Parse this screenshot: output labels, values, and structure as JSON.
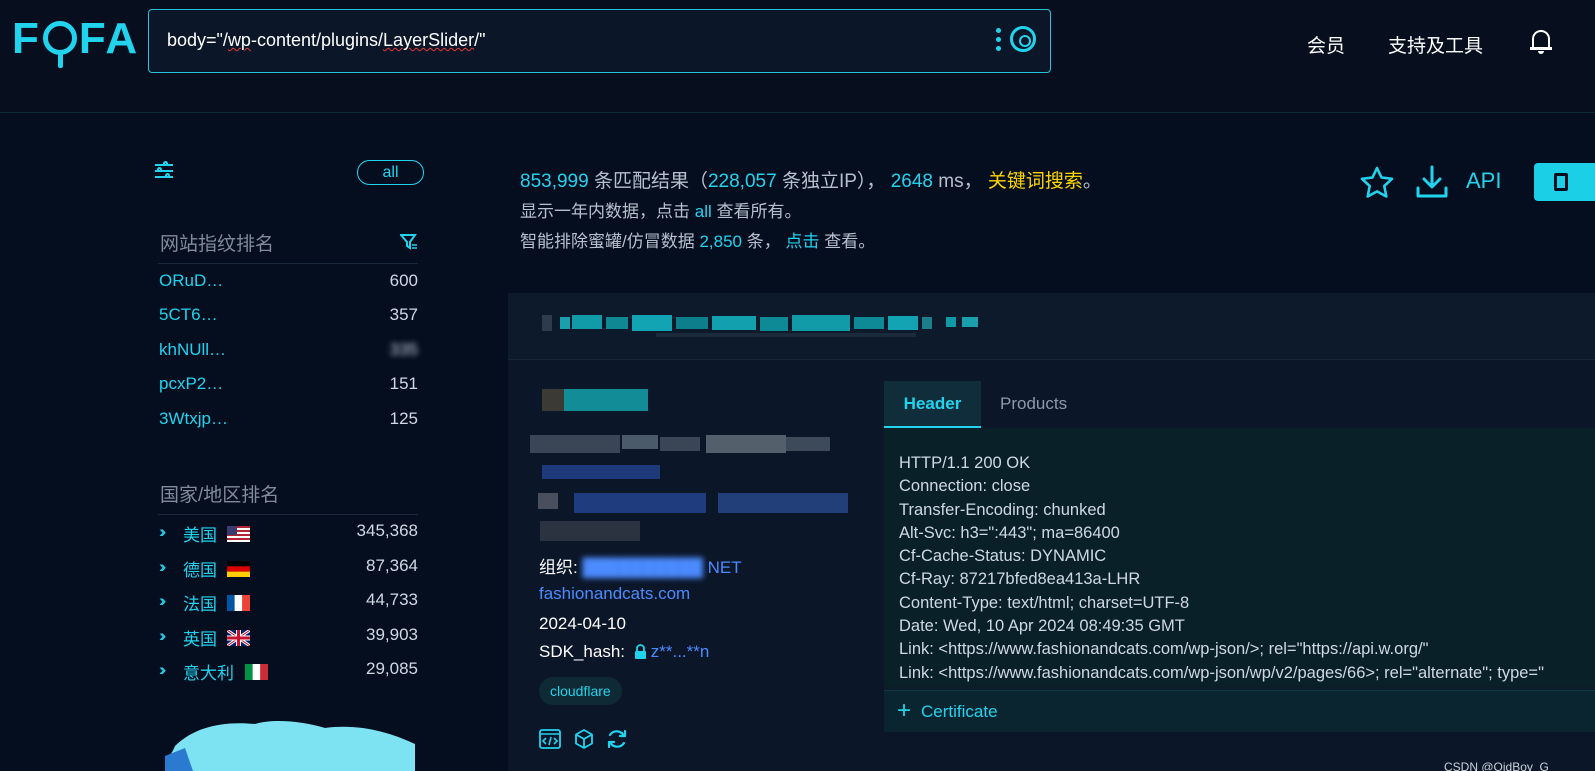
{
  "header": {
    "logo": "FOFA",
    "search_query": "body=\"/wp-content/plugins/LayerSlider/\"",
    "nav": [
      "会员",
      "支持及工具"
    ]
  },
  "sidebar": {
    "all_label": "all",
    "fingerprint_title": "网站指纹排名",
    "fingerprints": [
      {
        "name": "ORuD…",
        "count": "600"
      },
      {
        "name": "5CT6…",
        "count": "357"
      },
      {
        "name": "khNUll…",
        "count": "335"
      },
      {
        "name": "pcxP2…",
        "count": "151"
      },
      {
        "name": "3Wtxjp…",
        "count": "125"
      }
    ],
    "country_title": "国家/地区排名",
    "countries": [
      {
        "name": "美国",
        "count": "345,368",
        "flag": "us"
      },
      {
        "name": "德国",
        "count": "87,364",
        "flag": "de"
      },
      {
        "name": "法国",
        "count": "44,733",
        "flag": "fr"
      },
      {
        "name": "英国",
        "count": "39,903",
        "flag": "gb"
      },
      {
        "name": "意大利",
        "count": "29,085",
        "flag": "it"
      }
    ]
  },
  "summary": {
    "total": "853,999",
    "total_label": "条匹配结果（",
    "unique_ip": "228,057",
    "unique_ip_label": "条独立IP），",
    "ms": "2648",
    "ms_label": "ms，",
    "keyword_search": "关键词搜索",
    "period": "。",
    "line2_prefix": "显示一年内数据，点击",
    "line2_link": "all",
    "line2_suffix": "查看所有。",
    "line3_prefix": "智能排除蜜罐/仿冒数据",
    "line3_count": "2,850",
    "line3_mid": "条，",
    "line3_link": "点击",
    "line3_suffix": "查看。",
    "api_label": "API"
  },
  "result": {
    "org_label": "组织:",
    "org_tail": "NET",
    "domain": "fashionandcats.com",
    "date": "2024-04-10",
    "sdk_label": "SDK_hash:",
    "sdk_value": "z**...**n",
    "tag": "cloudflare"
  },
  "panel": {
    "tab_header": "Header",
    "tab_products": "Products",
    "http_lines": [
      "HTTP/1.1 200 OK",
      "Connection: close",
      "Transfer-Encoding: chunked",
      "Alt-Svc: h3=\":443\"; ma=86400",
      "Cf-Cache-Status: DYNAMIC",
      "Cf-Ray: 87217bfed8ea413a-LHR",
      "Content-Type: text/html; charset=UTF-8",
      "Date: Wed, 10 Apr 2024 08:49:35 GMT",
      "Link: <https://www.fashionandcats.com/wp-json/>; rel=\"https://api.w.org/\"",
      "Link: <https://www.fashionandcats.com/wp-json/wp/v2/pages/66>; rel=\"alternate\"; type=\""
    ],
    "certificate_label": "Certificate"
  },
  "watermark": "CSDN @OidBoy_G"
}
